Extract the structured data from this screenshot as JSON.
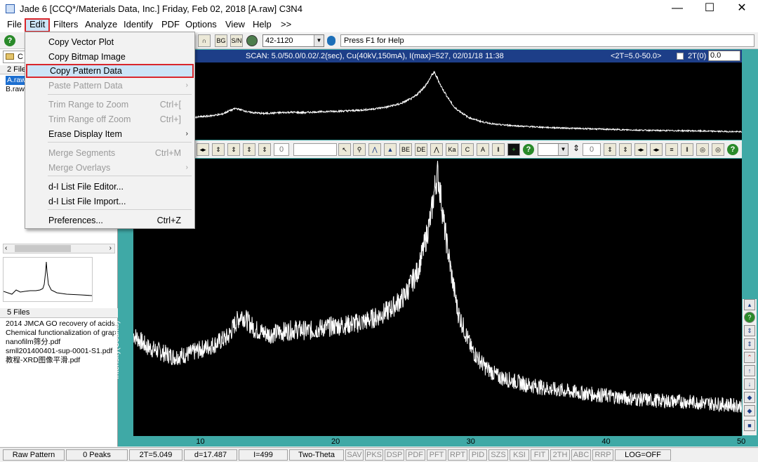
{
  "window": {
    "title": "Jade 6 [CCQ*/Materials Data, Inc.] Friday, Feb 02, 2018 [A.raw] C3N4",
    "minimize_glyph": "—",
    "maximize_glyph": "☐",
    "close_glyph": "✕"
  },
  "menu": {
    "items": [
      "File",
      "Edit",
      "Filters",
      "Analyze",
      "Identify",
      "PDF",
      "Options",
      "View",
      "Help",
      ">>"
    ],
    "selected": "Edit"
  },
  "toolbar": {
    "pdf_combo_value": "42-1120",
    "help_text": "Press F1 for Help",
    "buttons": [
      "?",
      "∩",
      "BG",
      "S/N"
    ]
  },
  "edit_menu": {
    "items": [
      {
        "label": "Copy Vector Plot",
        "shortcut": "",
        "submenu": false,
        "disabled": false
      },
      {
        "label": "Copy Bitmap Image",
        "shortcut": "",
        "submenu": false,
        "disabled": false
      },
      {
        "label": "Copy Pattern Data",
        "shortcut": "",
        "submenu": false,
        "disabled": false,
        "highlighted": true
      },
      {
        "label": "Paste Pattern Data",
        "shortcut": "",
        "submenu": true,
        "disabled": true
      },
      {
        "label": "Trim Range to Zoom",
        "shortcut": "Ctrl+[",
        "submenu": false,
        "disabled": true
      },
      {
        "label": "Trim Range off Zoom",
        "shortcut": "Ctrl+]",
        "submenu": false,
        "disabled": true
      },
      {
        "label": "Erase Display Item",
        "shortcut": "",
        "submenu": true,
        "disabled": false
      },
      {
        "label": "Merge Segments",
        "shortcut": "Ctrl+M",
        "submenu": false,
        "disabled": true
      },
      {
        "label": "Merge Overlays",
        "shortcut": "",
        "submenu": true,
        "disabled": true
      },
      {
        "label": "d-I List File Editor...",
        "shortcut": "",
        "submenu": false,
        "disabled": false
      },
      {
        "label": "d-I List File Import...",
        "shortcut": "",
        "submenu": false,
        "disabled": false
      },
      {
        "label": "Preferences...",
        "shortcut": "Ctrl+Z",
        "submenu": false,
        "disabled": false
      }
    ],
    "submenu_arrow": "›"
  },
  "left_panel": {
    "top_combo": "C",
    "files_count_label": "2 File",
    "files": [
      "A.raw",
      "B.raw"
    ],
    "files2_label": "5 Files",
    "docs": [
      "2014 JMCA GO recovery of acids.p",
      "Chemical functionalization of graph",
      "nanofilm筛分.pdf",
      "smll201400401-sup-0001-S1.pdf",
      "教程-XRD图像平滑.pdf"
    ]
  },
  "scan_info": {
    "text": "SCAN: 5.0/50.0/0.02/.2(sec), Cu(40kV,150mA), I(max)=527, 02/01/18 11:38",
    "range": "<2T=5.0-50.0>",
    "axis_mode": "2T(0)",
    "offset_value": "0.0"
  },
  "plot": {
    "ylabel": "Intensity(Counts)",
    "x_ticks": [
      "10",
      "20",
      "30",
      "40",
      "50"
    ]
  },
  "mid_toolbar": {
    "field1_value": "0",
    "field2_value": "0"
  },
  "status": {
    "items": [
      "Raw Pattern",
      "0 Peaks",
      "2T=5.049",
      "d=17.487",
      "I=499",
      "Two-Theta",
      "SAV",
      "PKS",
      "DSP",
      "PDF",
      "PFT",
      "RPT",
      "PID",
      "SZS",
      "KSI",
      "FIT",
      "2TH",
      "ABC",
      "RRP",
      "LOG=OFF"
    ]
  },
  "chart_data": {
    "type": "line",
    "ylabel": "Intensity(Counts)",
    "xlim": [
      5,
      50
    ],
    "x_ticks": [
      10,
      20,
      30,
      40,
      50
    ],
    "series": [
      {
        "x": [
          5,
          6,
          7,
          8,
          9,
          10,
          11,
          12,
          12.5,
          13,
          13.5,
          14,
          15,
          16,
          17,
          18,
          19,
          20,
          21,
          22,
          23,
          24,
          25,
          26,
          26.5,
          27,
          27.3,
          27.5,
          27.7,
          28,
          28.5,
          29,
          30,
          31,
          32,
          34,
          36,
          38,
          40,
          42,
          44,
          46,
          48,
          50
        ],
        "values": [
          205,
          180,
          170,
          160,
          165,
          175,
          185,
          200,
          225,
          245,
          230,
          215,
          205,
          210,
          215,
          212,
          218,
          222,
          225,
          230,
          240,
          255,
          280,
          330,
          380,
          440,
          500,
          527,
          490,
          420,
          330,
          250,
          175,
          140,
          120,
          105,
          95,
          88,
          82,
          76,
          72,
          70,
          66,
          62
        ]
      }
    ],
    "grid": false
  }
}
